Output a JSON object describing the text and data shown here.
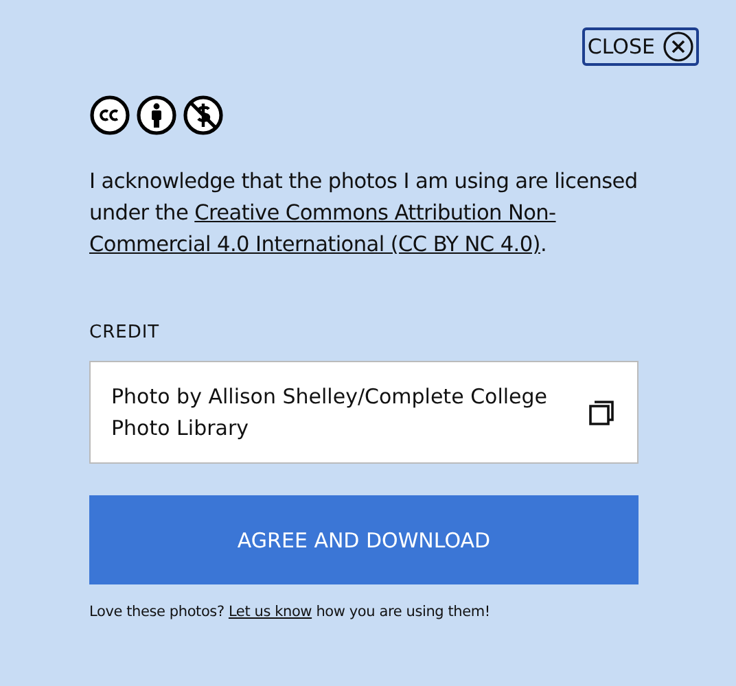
{
  "close_button": {
    "label": "CLOSE"
  },
  "acknowledgement": {
    "text": "I acknowledge that the photos I am using are licensed under the ",
    "link_lines": [
      "Creative Commons Attribution Non-",
      "Commercial 4.0 International (CC BY  NC 4.0)"
    ],
    "end": "."
  },
  "credit": {
    "label": "CREDIT",
    "value": "Photo by Allison Shelley/Complete College Photo Library"
  },
  "agree_button": {
    "label": "AGREE AND DOWNLOAD"
  },
  "footer": {
    "text": "Love these photos? ",
    "link": "Let us know",
    "end": " how you are using them!"
  }
}
